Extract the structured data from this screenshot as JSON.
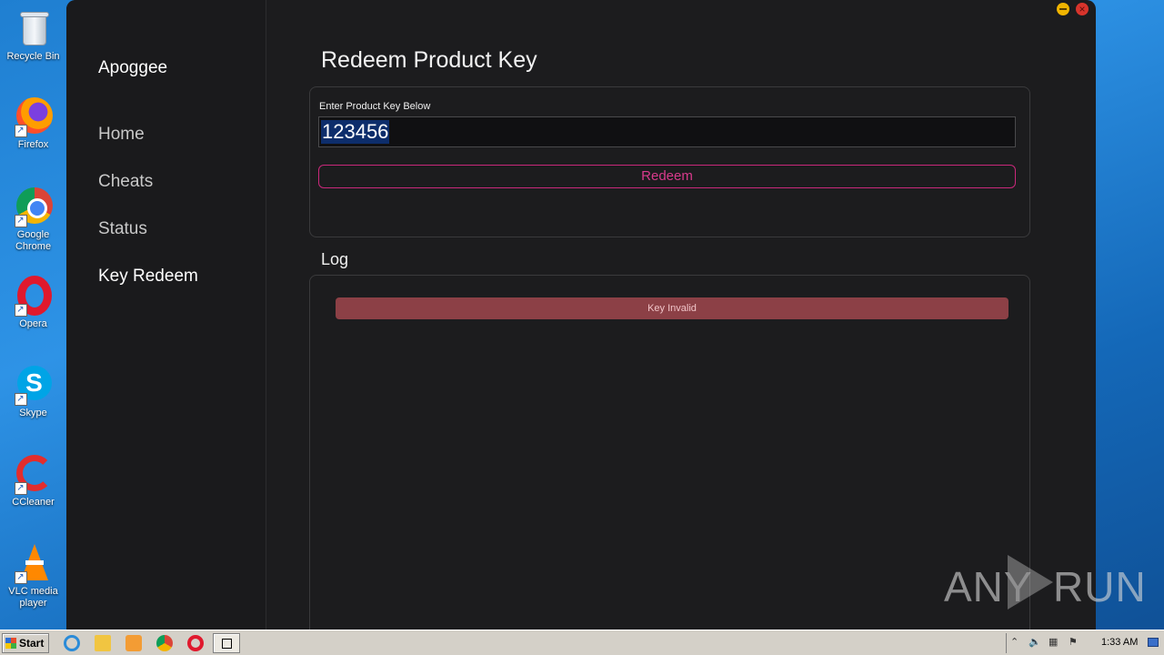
{
  "desktop": {
    "icons": [
      {
        "label": "Recycle Bin"
      },
      {
        "label": "Firefox"
      },
      {
        "label": "Google Chrome"
      },
      {
        "label": "Opera"
      },
      {
        "label": "Skype"
      },
      {
        "label": "CCleaner"
      },
      {
        "label": "VLC media player"
      }
    ]
  },
  "app": {
    "brand": "Apoggee",
    "nav": [
      "Home",
      "Cheats",
      "Status",
      "Key Redeem"
    ],
    "active_nav": "Key Redeem",
    "page_title": "Redeem Product Key",
    "field_label": "Enter Product Key Below",
    "key_value": "123456",
    "redeem_label": "Redeem",
    "log_title": "Log",
    "log_entries": [
      "Key Invalid"
    ],
    "colors": {
      "accent": "#d83a8c",
      "error": "#8c4046",
      "background": "#1c1c1e"
    }
  },
  "watermark": {
    "left": "ANY",
    "right": "RUN"
  },
  "taskbar": {
    "start_label": "Start",
    "pinned": [
      "ie-icon",
      "folder-icon",
      "media-player-icon",
      "chrome-icon",
      "opera-icon",
      "app-window-icon"
    ],
    "clock": "1:33 AM"
  }
}
